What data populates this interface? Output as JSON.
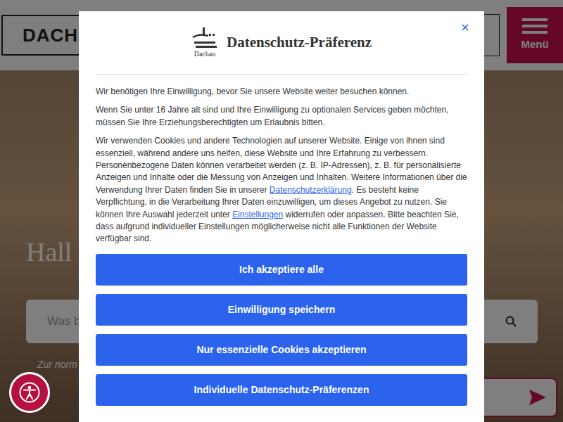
{
  "header": {
    "logo": "DACHA",
    "menu_label": "Menü"
  },
  "hero": {
    "heading": "Hall",
    "search_placeholder": "Was b",
    "note": "Zur norm"
  },
  "modal": {
    "logo_caption": "Dachau",
    "title": "Datenschutz-Präferenz",
    "paragraphs": [
      [
        {
          "text": "Wir benötigen Ihre Einwilligung, bevor Sie unsere Website weiter besuchen können.",
          "link": false
        }
      ],
      [
        {
          "text": "Wenn Sie unter 16 Jahre alt sind und Ihre Einwilligung zu optionalen Services geben möchten, müssen Sie Ihre Erziehungsberechtigten um Erlaubnis bitten.",
          "link": false
        }
      ],
      [
        {
          "text": "Wir verwenden Cookies und andere Technologien auf unserer Website. Einige von ihnen sind essenziell, während andere uns helfen, diese Website und Ihre Erfahrung zu verbessern. Personenbezogene Daten können verarbeitet werden (z. B. IP-Adressen), z. B. für personalisierte Anzeigen und Inhalte oder die Messung von Anzeigen und Inhalten. Weitere Informationen über die Verwendung Ihrer Daten finden Sie in unserer ",
          "link": false
        },
        {
          "text": "Datenschutzerklärung",
          "link": true
        },
        {
          "text": ". Es besteht keine Verpflichtung, in die Verarbeitung Ihrer Daten einzuwilligen, um dieses Angebot zu nutzen. Sie können Ihre Auswahl jederzeit unter ",
          "link": false
        },
        {
          "text": "Einstellungen",
          "link": true
        },
        {
          "text": " widerrufen oder anpassen. Bitte beachten Sie, dass aufgrund individueller Einstellungen möglicherweise nicht alle Funktionen der Website verfügbar sind.",
          "link": false
        }
      ]
    ],
    "buttons": [
      "Ich akzeptiere alle",
      "Einwilligung speichern",
      "Nur essenzielle Cookies akzeptieren",
      "Individuelle Datenschutz-Präferenzen"
    ]
  }
}
